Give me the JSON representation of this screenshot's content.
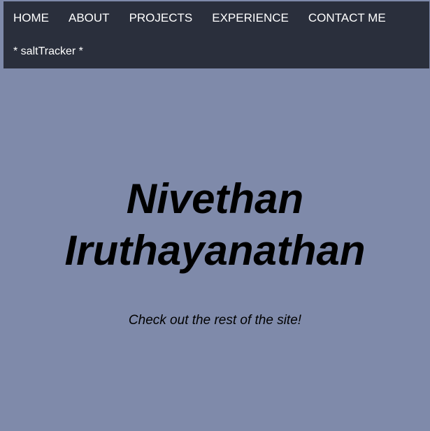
{
  "nav": {
    "items": [
      {
        "label": "HOME"
      },
      {
        "label": "ABOUT"
      },
      {
        "label": "PROJECTS"
      },
      {
        "label": "EXPERIENCE"
      },
      {
        "label": "CONTACT ME"
      },
      {
        "label": "* saltTracker *"
      }
    ]
  },
  "hero": {
    "name_line1": "Nivethan",
    "name_line2": "Iruthayanathan",
    "subtitle": "Check out the rest of the site!"
  },
  "colors": {
    "background": "#7f8aaa",
    "navbar": "#2a2f3c",
    "nav_text": "#ffffff",
    "hero_text": "#000000"
  }
}
